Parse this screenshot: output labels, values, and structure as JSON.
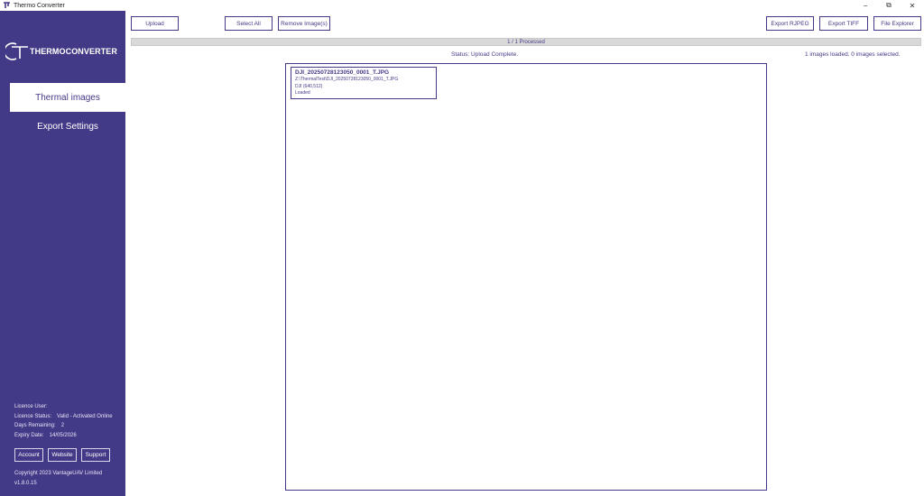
{
  "window": {
    "title": "Thermo Converter",
    "controls": {
      "minimize": "−",
      "restore": "⧉",
      "close": "✕"
    }
  },
  "sidebar": {
    "logo_text": "THERMOCONVERTER",
    "nav": [
      {
        "label": "Thermal images",
        "active": true
      },
      {
        "label": "Export Settings",
        "active": false
      }
    ],
    "license": {
      "user_label": "Licence User:",
      "user_value": "",
      "status_label": "Licence Status:",
      "status_value": "Valid - Activated Online",
      "days_label": "Days Remaining:",
      "days_value": "2",
      "expiry_label": "Expiry Date:",
      "expiry_value": "14/05/2026"
    },
    "buttons": {
      "account": "Account",
      "website": "Website",
      "support": "Support"
    },
    "copyright": "Copyright 2023 VantageUAV Limited",
    "version": "v1.8.0.15"
  },
  "toolbar": {
    "upload": "Upload",
    "select_all": "Select All",
    "remove_images": "Remove Image(s)",
    "export_rjpeg": "Export RJPEG",
    "export_tiff": "Export TIFF",
    "file_explorer": "File Explorer"
  },
  "progress": {
    "label": "1 / 1 Processed",
    "fraction": 1.0
  },
  "status": {
    "message": "Status: Upload Complete.",
    "counts": "1 images loaded. 0 images selected."
  },
  "images": [
    {
      "name": "DJI_20250728123050_0001_T.JPG",
      "path": "Z:\\ThermalTest\\DJI_20250728123050_0001_T.JPG",
      "info": "DJI (640,512)",
      "state": "Loaded"
    }
  ],
  "colors": {
    "brand": "#433a87",
    "background": "#ffffff",
    "progress": "#d9d9d9"
  }
}
